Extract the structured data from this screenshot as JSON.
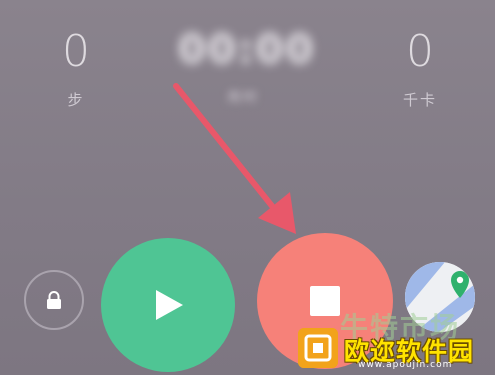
{
  "stats": {
    "steps": {
      "value": "0",
      "label": "步"
    },
    "duration": {
      "value": "00:00",
      "label": "用时"
    },
    "calories": {
      "value": "0",
      "label": "千卡"
    }
  },
  "controls": {
    "lock": {
      "icon": "lock-icon"
    },
    "play": {
      "icon": "play-icon",
      "color": "#4fc594"
    },
    "stop": {
      "icon": "stop-icon",
      "color": "#f68179"
    },
    "map": {
      "icon": "map-location-icon"
    }
  },
  "annotation": {
    "arrow_color": "#e8586a",
    "points_to": "stop-button"
  },
  "watermark": {
    "faded_text": "牛特市场",
    "name": "欧迩软件园",
    "url": "www.apoujin.com"
  },
  "colors": {
    "background": "#847d88",
    "accent_green": "#4fc594",
    "accent_red": "#f68179"
  }
}
